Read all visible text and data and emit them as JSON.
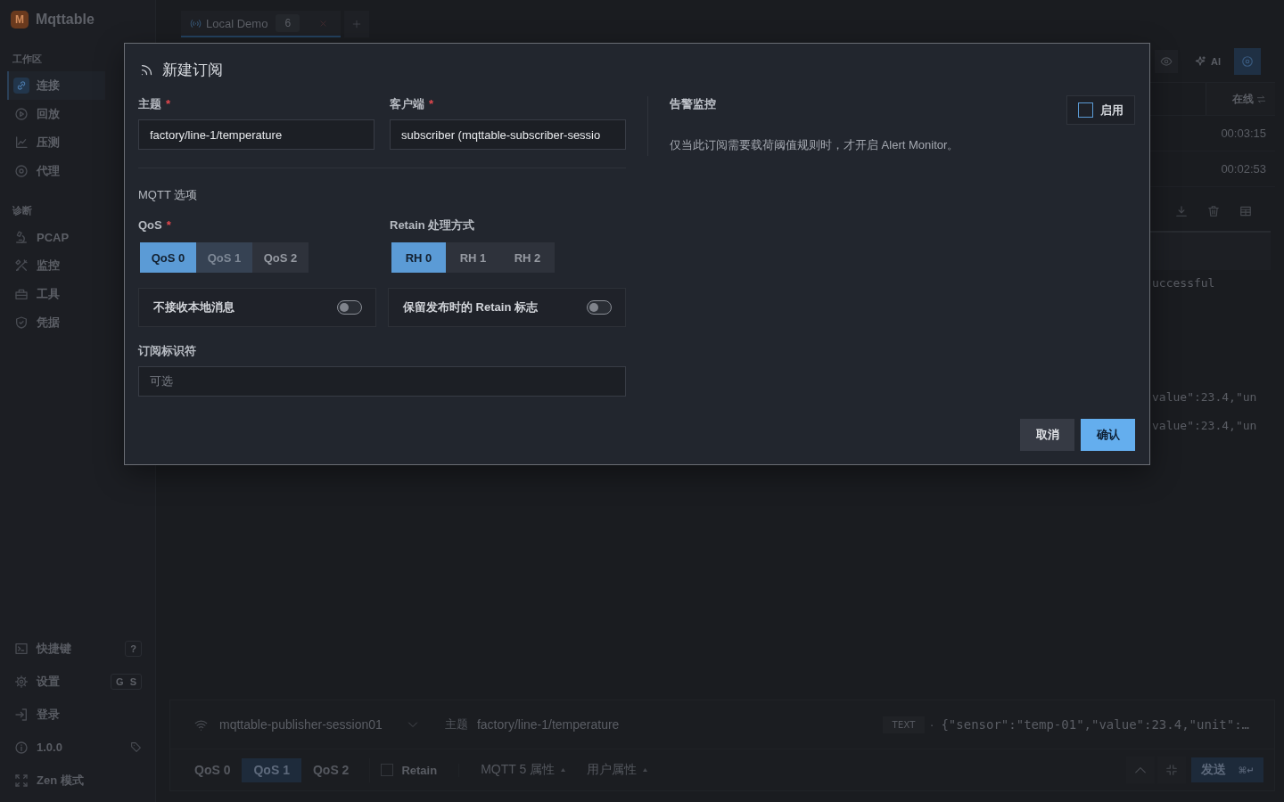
{
  "app": {
    "logo_mark": "M",
    "name": "Mqttable"
  },
  "sidebar": {
    "sections": [
      {
        "title": "工作区",
        "items": [
          {
            "label": "连接",
            "selected": true
          },
          {
            "label": "回放",
            "selected": false
          },
          {
            "label": "压测",
            "selected": false
          },
          {
            "label": "代理",
            "selected": false
          }
        ]
      },
      {
        "title": "诊断",
        "items": [
          {
            "label": "PCAP",
            "selected": false
          },
          {
            "label": "监控",
            "selected": false
          },
          {
            "label": "工具",
            "selected": false
          },
          {
            "label": "凭据",
            "selected": false
          }
        ]
      }
    ],
    "footer": [
      {
        "label": "快捷键",
        "shortcut": "?"
      },
      {
        "label": "设置",
        "shortcut": "G S"
      },
      {
        "label": "登录"
      },
      {
        "label": "1.0.0"
      },
      {
        "label": "Zen 模式"
      }
    ]
  },
  "tabs": [
    {
      "label": "Local Demo",
      "count": "6",
      "selected": true
    }
  ],
  "toolbar": {
    "ai_label": "AI"
  },
  "session_table": {
    "column_header": "在线",
    "rows": [
      "00:03:15",
      "00:02:53"
    ]
  },
  "log_lines": [
    "uccessful",
    "value\":23.4,\"un",
    "value\":23.4,\"un"
  ],
  "composer": {
    "client": "mqttable-publisher-session01",
    "topic_label": "主题",
    "topic": "factory/line-1/temperature",
    "format": "TEXT",
    "separator": "·",
    "payload": "{\"sensor\":\"temp-01\",\"value\":23.4,\"unit\":…",
    "qos_options": [
      {
        "label": "QoS 0",
        "selected": false
      },
      {
        "label": "QoS 1",
        "selected": true
      },
      {
        "label": "QoS 2",
        "selected": false
      }
    ],
    "retain": {
      "label": "Retain",
      "checked": false
    },
    "sections": [
      {
        "label": "MQTT 5 属性"
      },
      {
        "label": "用户属性"
      }
    ],
    "send": {
      "label": "发送",
      "shortcut": "⌘↵"
    }
  },
  "modal": {
    "title": "新建订阅",
    "fields": [
      {
        "label": "主题",
        "required_mark": "*",
        "value": "factory/line-1/temperature"
      },
      {
        "label": "客户端",
        "required_mark": "*",
        "value": "subscriber (mqttable-subscriber-sessio"
      }
    ],
    "options_title": "MQTT 选项",
    "qos": {
      "label": "QoS",
      "required_mark": "*",
      "options": [
        {
          "label": "QoS 0",
          "selected": true,
          "hovered": false
        },
        {
          "label": "QoS 1",
          "selected": false,
          "hovered": true
        },
        {
          "label": "QoS 2",
          "selected": false,
          "hovered": false
        }
      ]
    },
    "retain_handling": {
      "label": "Retain 处理方式",
      "options": [
        {
          "label": "RH 0",
          "selected": true
        },
        {
          "label": "RH 1",
          "selected": false
        },
        {
          "label": "RH 2",
          "selected": false
        }
      ]
    },
    "toggles": [
      {
        "label": "不接收本地消息",
        "on": false
      },
      {
        "label": "保留发布时的 Retain 标志",
        "on": false
      }
    ],
    "subscription_id": {
      "label": "订阅标识符",
      "placeholder": "可选"
    },
    "alert": {
      "title": "告警监控",
      "enable_label": "启用",
      "checked": false,
      "description": "仅当此订阅需要载荷阈值规则时，才开启 Alert Monitor。"
    },
    "buttons": [
      {
        "label": "取消",
        "kind": "secondary"
      },
      {
        "label": "确认",
        "kind": "primary"
      }
    ]
  }
}
